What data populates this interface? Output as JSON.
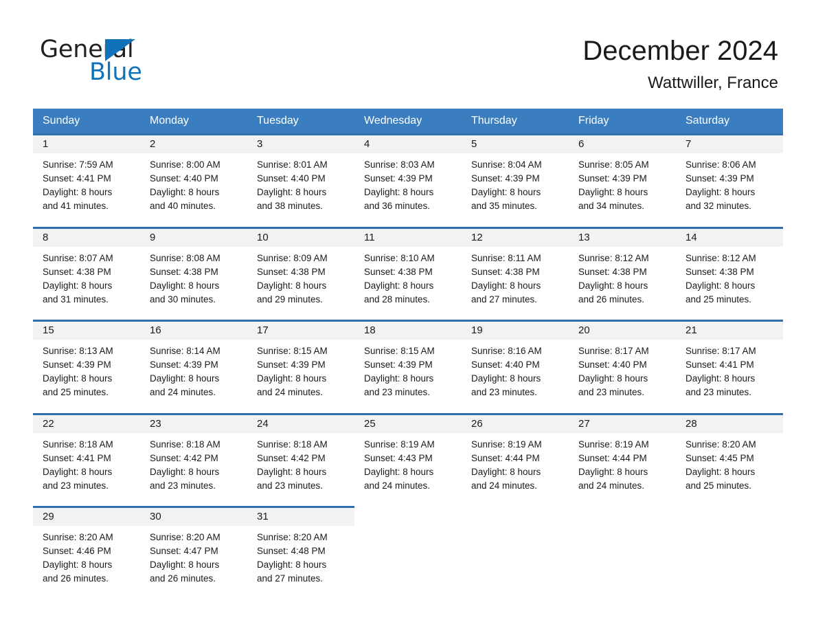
{
  "brand": {
    "name_part1": "General",
    "name_part2": "Blue",
    "triangle_icon": "triangle-icon",
    "accent_color": "#1073b9"
  },
  "header": {
    "title": "December 2024",
    "location": "Wattwiller, France"
  },
  "calendar": {
    "header_bg": "#3b7ebf",
    "row_divider_color": "#2f6fb0",
    "daynum_band_bg": "#f2f2f2",
    "weekdays": [
      "Sunday",
      "Monday",
      "Tuesday",
      "Wednesday",
      "Thursday",
      "Friday",
      "Saturday"
    ],
    "weeks": [
      [
        {
          "day": "1",
          "info": "Sunrise: 7:59 AM\nSunset: 4:41 PM\nDaylight: 8 hours\nand 41 minutes."
        },
        {
          "day": "2",
          "info": "Sunrise: 8:00 AM\nSunset: 4:40 PM\nDaylight: 8 hours\nand 40 minutes."
        },
        {
          "day": "3",
          "info": "Sunrise: 8:01 AM\nSunset: 4:40 PM\nDaylight: 8 hours\nand 38 minutes."
        },
        {
          "day": "4",
          "info": "Sunrise: 8:03 AM\nSunset: 4:39 PM\nDaylight: 8 hours\nand 36 minutes."
        },
        {
          "day": "5",
          "info": "Sunrise: 8:04 AM\nSunset: 4:39 PM\nDaylight: 8 hours\nand 35 minutes."
        },
        {
          "day": "6",
          "info": "Sunrise: 8:05 AM\nSunset: 4:39 PM\nDaylight: 8 hours\nand 34 minutes."
        },
        {
          "day": "7",
          "info": "Sunrise: 8:06 AM\nSunset: 4:39 PM\nDaylight: 8 hours\nand 32 minutes."
        }
      ],
      [
        {
          "day": "8",
          "info": "Sunrise: 8:07 AM\nSunset: 4:38 PM\nDaylight: 8 hours\nand 31 minutes."
        },
        {
          "day": "9",
          "info": "Sunrise: 8:08 AM\nSunset: 4:38 PM\nDaylight: 8 hours\nand 30 minutes."
        },
        {
          "day": "10",
          "info": "Sunrise: 8:09 AM\nSunset: 4:38 PM\nDaylight: 8 hours\nand 29 minutes."
        },
        {
          "day": "11",
          "info": "Sunrise: 8:10 AM\nSunset: 4:38 PM\nDaylight: 8 hours\nand 28 minutes."
        },
        {
          "day": "12",
          "info": "Sunrise: 8:11 AM\nSunset: 4:38 PM\nDaylight: 8 hours\nand 27 minutes."
        },
        {
          "day": "13",
          "info": "Sunrise: 8:12 AM\nSunset: 4:38 PM\nDaylight: 8 hours\nand 26 minutes."
        },
        {
          "day": "14",
          "info": "Sunrise: 8:12 AM\nSunset: 4:38 PM\nDaylight: 8 hours\nand 25 minutes."
        }
      ],
      [
        {
          "day": "15",
          "info": "Sunrise: 8:13 AM\nSunset: 4:39 PM\nDaylight: 8 hours\nand 25 minutes."
        },
        {
          "day": "16",
          "info": "Sunrise: 8:14 AM\nSunset: 4:39 PM\nDaylight: 8 hours\nand 24 minutes."
        },
        {
          "day": "17",
          "info": "Sunrise: 8:15 AM\nSunset: 4:39 PM\nDaylight: 8 hours\nand 24 minutes."
        },
        {
          "day": "18",
          "info": "Sunrise: 8:15 AM\nSunset: 4:39 PM\nDaylight: 8 hours\nand 23 minutes."
        },
        {
          "day": "19",
          "info": "Sunrise: 8:16 AM\nSunset: 4:40 PM\nDaylight: 8 hours\nand 23 minutes."
        },
        {
          "day": "20",
          "info": "Sunrise: 8:17 AM\nSunset: 4:40 PM\nDaylight: 8 hours\nand 23 minutes."
        },
        {
          "day": "21",
          "info": "Sunrise: 8:17 AM\nSunset: 4:41 PM\nDaylight: 8 hours\nand 23 minutes."
        }
      ],
      [
        {
          "day": "22",
          "info": "Sunrise: 8:18 AM\nSunset: 4:41 PM\nDaylight: 8 hours\nand 23 minutes."
        },
        {
          "day": "23",
          "info": "Sunrise: 8:18 AM\nSunset: 4:42 PM\nDaylight: 8 hours\nand 23 minutes."
        },
        {
          "day": "24",
          "info": "Sunrise: 8:18 AM\nSunset: 4:42 PM\nDaylight: 8 hours\nand 23 minutes."
        },
        {
          "day": "25",
          "info": "Sunrise: 8:19 AM\nSunset: 4:43 PM\nDaylight: 8 hours\nand 24 minutes."
        },
        {
          "day": "26",
          "info": "Sunrise: 8:19 AM\nSunset: 4:44 PM\nDaylight: 8 hours\nand 24 minutes."
        },
        {
          "day": "27",
          "info": "Sunrise: 8:19 AM\nSunset: 4:44 PM\nDaylight: 8 hours\nand 24 minutes."
        },
        {
          "day": "28",
          "info": "Sunrise: 8:20 AM\nSunset: 4:45 PM\nDaylight: 8 hours\nand 25 minutes."
        }
      ],
      [
        {
          "day": "29",
          "info": "Sunrise: 8:20 AM\nSunset: 4:46 PM\nDaylight: 8 hours\nand 26 minutes."
        },
        {
          "day": "30",
          "info": "Sunrise: 8:20 AM\nSunset: 4:47 PM\nDaylight: 8 hours\nand 26 minutes."
        },
        {
          "day": "31",
          "info": "Sunrise: 8:20 AM\nSunset: 4:48 PM\nDaylight: 8 hours\nand 27 minutes."
        },
        {
          "day": "",
          "info": ""
        },
        {
          "day": "",
          "info": ""
        },
        {
          "day": "",
          "info": ""
        },
        {
          "day": "",
          "info": ""
        }
      ]
    ]
  }
}
